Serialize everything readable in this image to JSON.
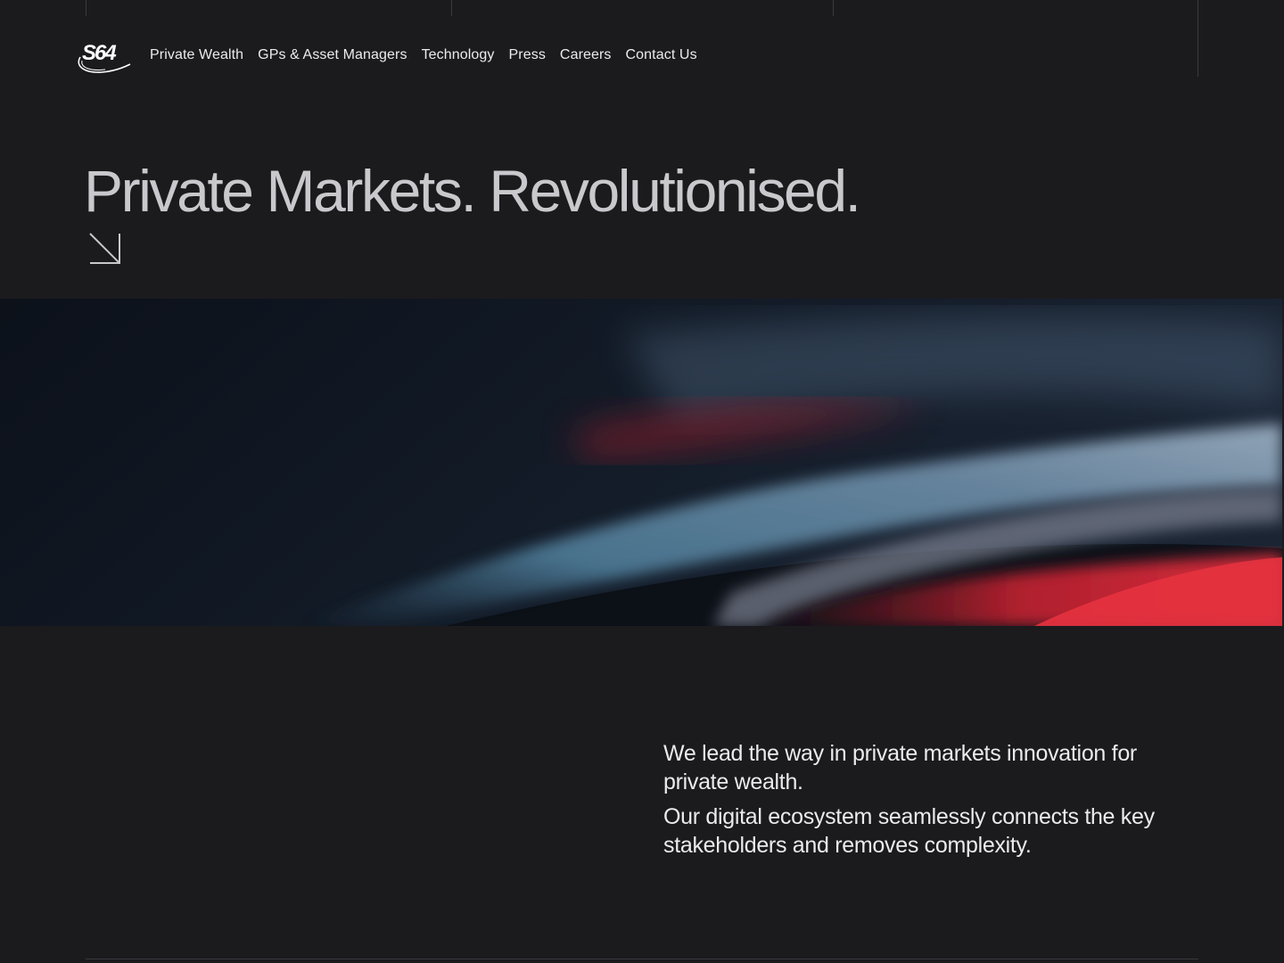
{
  "header": {
    "logo_text": "S64",
    "nav": [
      {
        "label": "Private Wealth"
      },
      {
        "label": "GPs & Asset Managers"
      },
      {
        "label": "Technology"
      },
      {
        "label": "Press"
      },
      {
        "label": "Careers"
      },
      {
        "label": "Contact Us"
      }
    ]
  },
  "hero": {
    "title": "Private Markets. Revolutionised.",
    "arrow_icon": "arrow-down-right-icon"
  },
  "intro": {
    "paragraph_1": "We lead the way in private markets innovation for private wealth.",
    "paragraph_2": "Our digital ecosystem seamlessly connects the key stakeholders and removes complexity."
  },
  "colors": {
    "background": "#1b1b1e",
    "text": "#ecebeb",
    "heading": "#c9c8cc",
    "accent_red": "#d8263a",
    "accent_blue": "#5a8aa8"
  }
}
